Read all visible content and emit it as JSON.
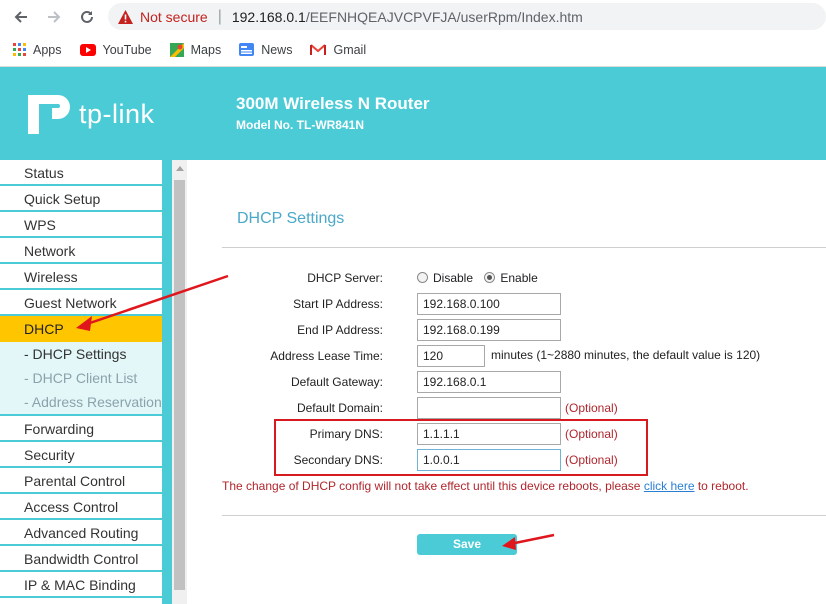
{
  "browser": {
    "security_label": "Not secure",
    "url_host": "192.168.0.1",
    "url_path": "/EEFNHQEAJVCPVFJA/userRpm/Index.htm",
    "bookmarks": [
      "Apps",
      "YouTube",
      "Maps",
      "News",
      "Gmail"
    ]
  },
  "header": {
    "logo_text": "tp-link",
    "product_name": "300M Wireless N Router",
    "model_no": "Model No. TL-WR841N",
    "bg_color": "#4acbd6"
  },
  "sidebar": {
    "items_top": [
      "Status",
      "Quick Setup",
      "WPS",
      "Network",
      "Wireless",
      "Guest Network"
    ],
    "active_item": "DHCP",
    "sub_items": [
      "- DHCP Settings",
      "- DHCP Client List",
      "- Address Reservation"
    ],
    "items_bottom": [
      "Forwarding",
      "Security",
      "Parental Control",
      "Access Control",
      "Advanced Routing",
      "Bandwidth Control",
      "IP & MAC Binding"
    ]
  },
  "form": {
    "title": "DHCP Settings",
    "dhcp_server_label": "DHCP Server:",
    "disable_label": "Disable",
    "enable_label": "Enable",
    "selected": "Enable",
    "start_ip_label": "Start IP Address:",
    "start_ip": "192.168.0.100",
    "end_ip_label": "End IP Address:",
    "end_ip": "192.168.0.199",
    "lease_label": "Address Lease Time:",
    "lease_value": "120",
    "lease_hint": "minutes (1~2880 minutes, the default value is 120)",
    "gateway_label": "Default Gateway:",
    "gateway": "192.168.0.1",
    "domain_label": "Default Domain:",
    "domain": "",
    "optional": "(Optional)",
    "primary_dns_label": "Primary DNS:",
    "primary_dns": "1.1.1.1",
    "secondary_dns_label": "Secondary DNS:",
    "secondary_dns": "1.0.0.1",
    "warning_text": "The change of DHCP config will not take effect until this device reboots, please",
    "warning_link": "click here",
    "warning_tail": "to reboot.",
    "save_label": "Save"
  }
}
